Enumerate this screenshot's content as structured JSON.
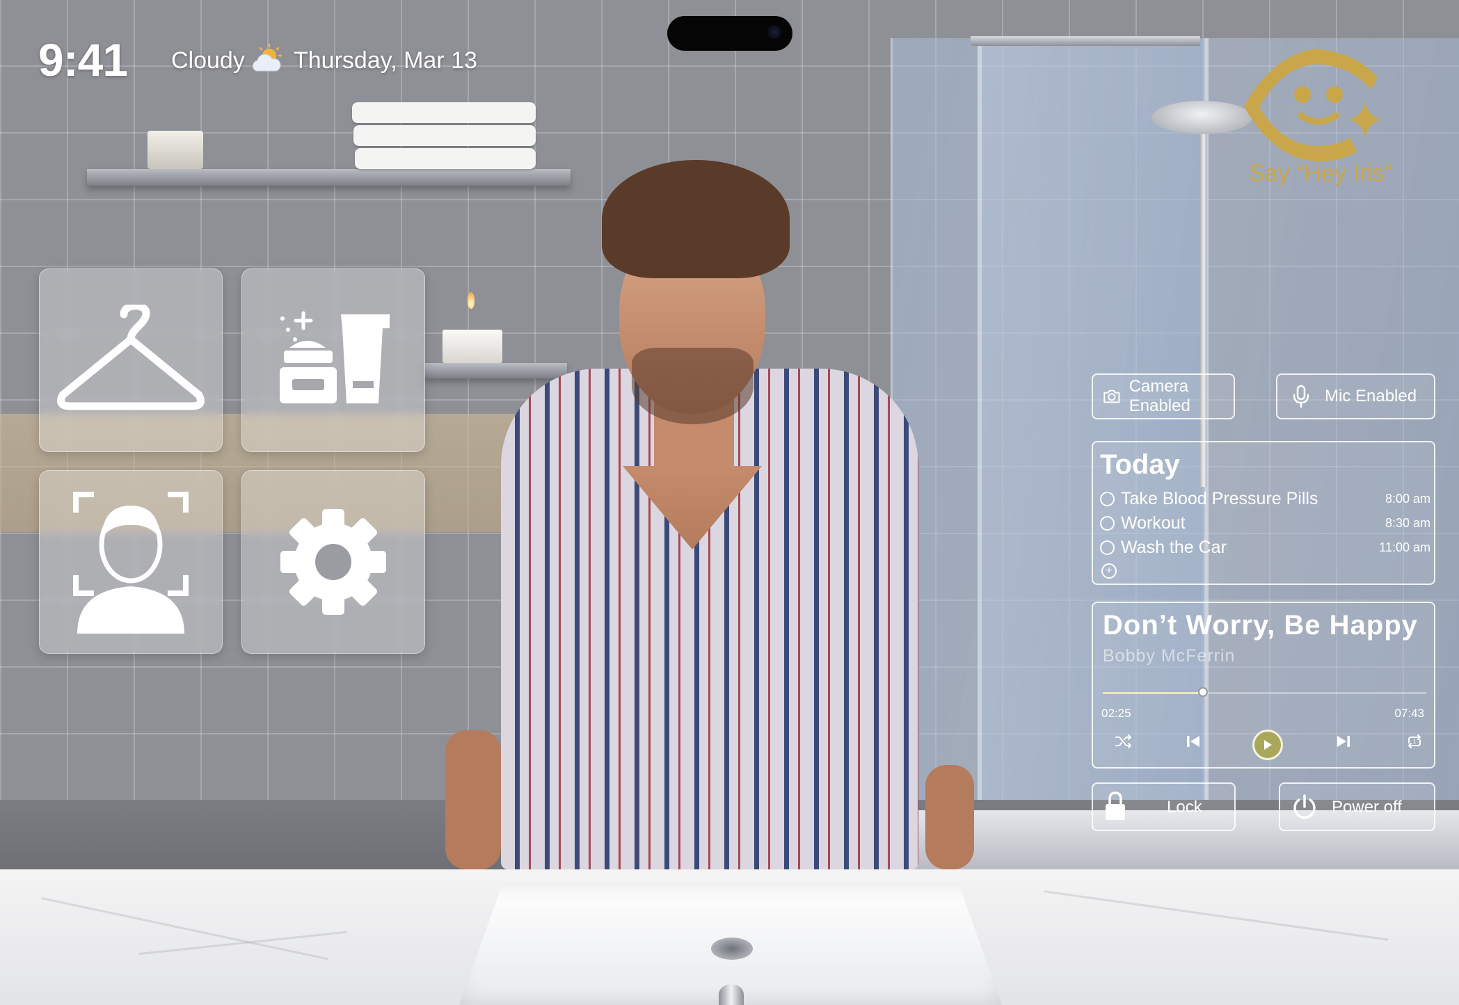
{
  "status_bar": {
    "time": "9:41",
    "weather": "Cloudy",
    "weather_icon": "partly-cloudy-icon",
    "date": "Thursday, Mar 13"
  },
  "tiles": [
    {
      "name": "wardrobe",
      "icon": "clothes-hanger-icon"
    },
    {
      "name": "skincare",
      "icon": "cosmetics-icon"
    },
    {
      "name": "face-scan",
      "icon": "face-scan-icon"
    },
    {
      "name": "settings",
      "icon": "gear-icon"
    }
  ],
  "assistant": {
    "prompt": "Say “Hey Iris”",
    "logo_icon": "iris-logo-icon",
    "accent_color": "#c9a64a"
  },
  "toggles": {
    "camera": {
      "label": "Camera Enabled",
      "icon": "camera-icon"
    },
    "mic": {
      "label": "Mic Enabled",
      "icon": "microphone-icon"
    }
  },
  "today": {
    "title": "Today",
    "tasks": [
      {
        "label": "Take Blood Pressure Pills",
        "time": "8:00 am"
      },
      {
        "label": "Workout",
        "time": "8:30 am"
      },
      {
        "label": "Wash the Car",
        "time": "11:00 am"
      }
    ],
    "add_icon": "add-circle-icon"
  },
  "music": {
    "title": "Don’t Worry, Be Happy",
    "artist": "Bobby McFerrin",
    "elapsed": "02:25",
    "total": "07:43",
    "progress": 0.31,
    "controls": [
      "shuffle-icon",
      "previous-track-icon",
      "play-icon",
      "next-track-icon",
      "repeat-icon"
    ],
    "play_color": "#a9a85a"
  },
  "actions": {
    "lock": {
      "label": "Lock",
      "icon": "lock-icon"
    },
    "power": {
      "label": "Power off",
      "icon": "power-icon"
    }
  }
}
